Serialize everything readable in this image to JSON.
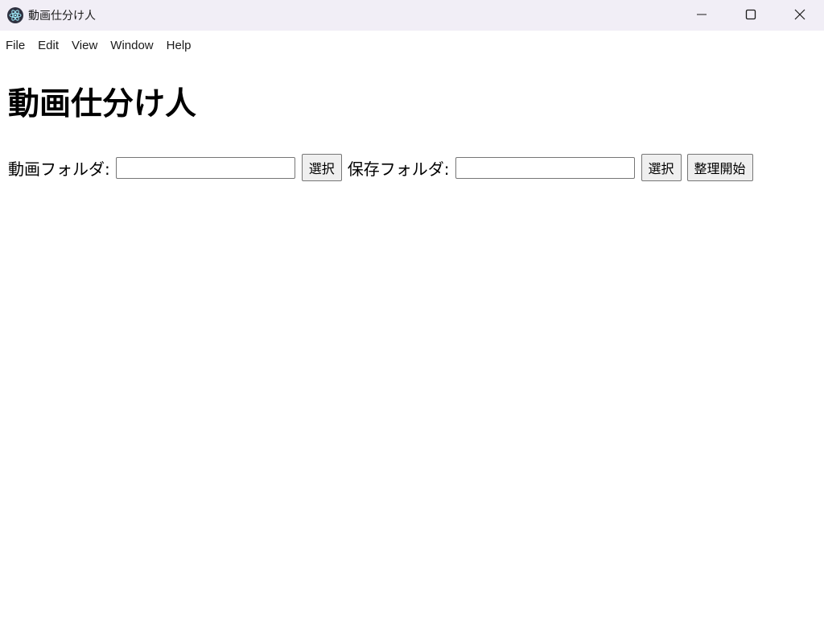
{
  "window": {
    "title": "動画仕分け人",
    "icon": "electron-logo-icon",
    "controls": [
      "minimize-icon",
      "maximize-icon",
      "close-icon"
    ]
  },
  "menu": {
    "items": [
      "File",
      "Edit",
      "View",
      "Window",
      "Help"
    ]
  },
  "main": {
    "heading": "動画仕分け人",
    "video_folder": {
      "label": "動画フォルダ:",
      "value": "",
      "select_label": "選択"
    },
    "save_folder": {
      "label": "保存フォルダ:",
      "value": "",
      "select_label": "選択"
    },
    "start_label": "整理開始"
  },
  "colors": {
    "titlebar_bg": "#f1eef6",
    "button_bg": "#efefef",
    "border": "#767676"
  }
}
